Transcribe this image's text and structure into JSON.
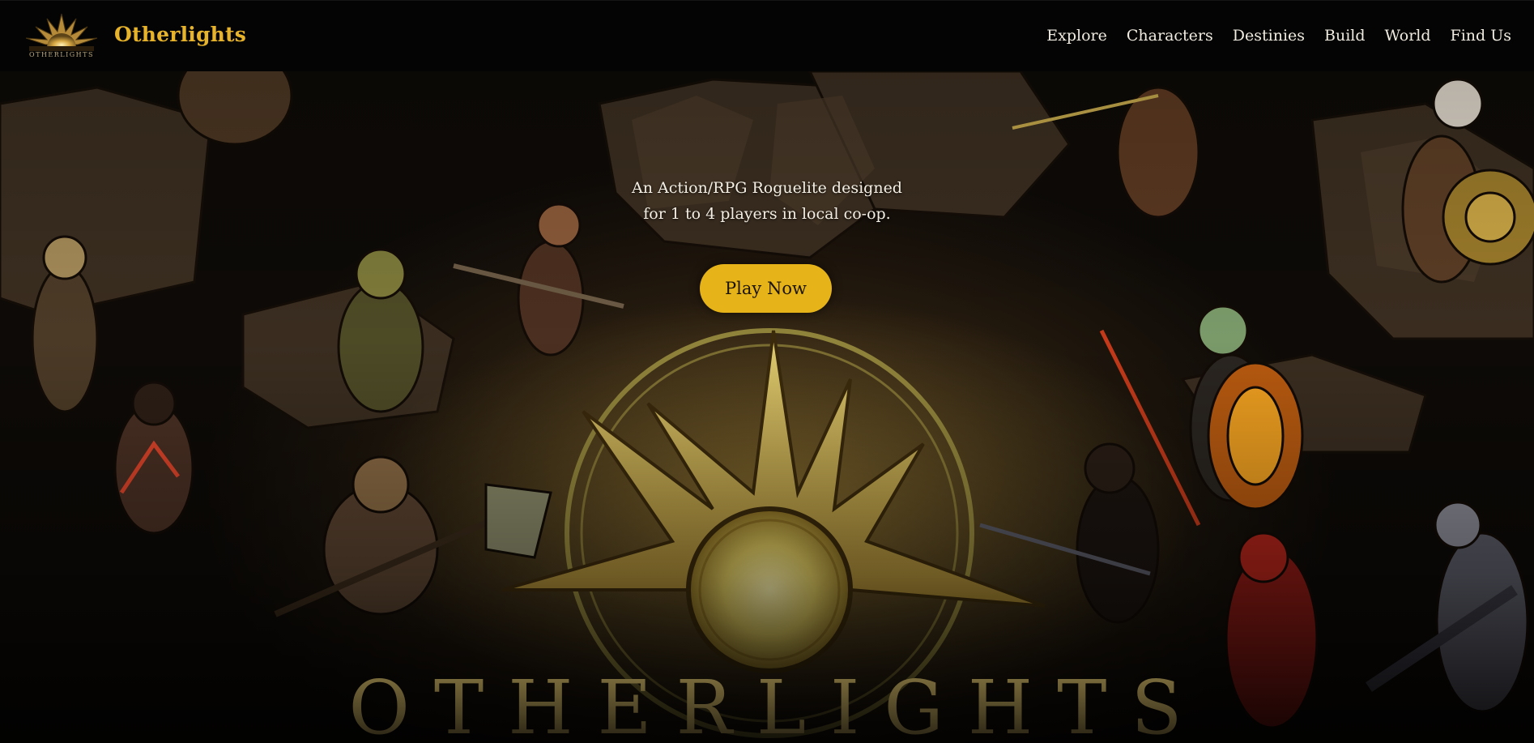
{
  "header": {
    "logo_emblem_text": "OTHERLIGHTS",
    "brand_title": "Otherlights",
    "nav": [
      {
        "label": "Explore"
      },
      {
        "label": "Characters"
      },
      {
        "label": "Destinies"
      },
      {
        "label": "Build"
      },
      {
        "label": "World"
      },
      {
        "label": "Find Us"
      }
    ]
  },
  "hero": {
    "tagline_line1": "An Action/RPG Roguelite designed",
    "tagline_line2": "for 1 to 4 players in local co-op.",
    "cta_label": "Play Now",
    "wordmark": "OTHERLIGHTS"
  },
  "colors": {
    "brand_gold": "#e7b32b",
    "cta_background": "#e6b419",
    "nav_text": "#f1ece1",
    "header_background": "#040404"
  },
  "icons": {
    "logo": "sun-emblem-icon",
    "hero_center": "sun-emblem-icon"
  }
}
